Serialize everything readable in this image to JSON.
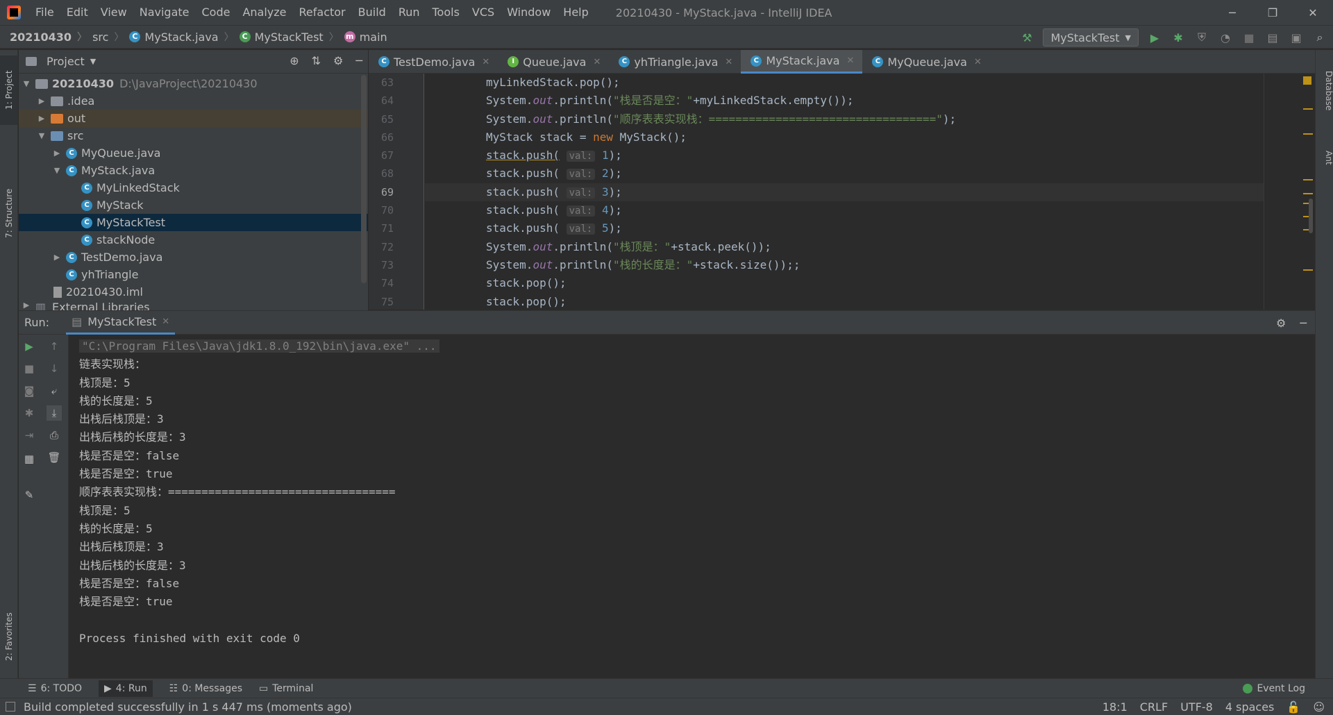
{
  "menu": [
    "File",
    "Edit",
    "View",
    "Navigate",
    "Code",
    "Analyze",
    "Refactor",
    "Build",
    "Run",
    "Tools",
    "VCS",
    "Window",
    "Help"
  ],
  "window_title": "20210430 - MyStack.java - IntelliJ IDEA",
  "breadcrumb": [
    "20210430",
    "src",
    "MyStack.java",
    "MyStackTest",
    "main"
  ],
  "run_config": "MyStackTest",
  "project_panel": {
    "title": "Project",
    "tree": [
      {
        "label": "20210430",
        "path": "D:\\JavaProject\\20210430"
      },
      {
        "label": ".idea"
      },
      {
        "label": "out"
      },
      {
        "label": "src"
      },
      {
        "label": "MyQueue.java"
      },
      {
        "label": "MyStack.java"
      },
      {
        "label": "MyLinkedStack"
      },
      {
        "label": "MyStack"
      },
      {
        "label": "MyStackTest"
      },
      {
        "label": "stackNode"
      },
      {
        "label": "TestDemo.java"
      },
      {
        "label": "yhTriangle"
      },
      {
        "label": "20210430.iml"
      },
      {
        "label": "External Libraries"
      }
    ]
  },
  "editor_tabs": [
    "TestDemo.java",
    "Queue.java",
    "yhTriangle.java",
    "MyStack.java",
    "MyQueue.java"
  ],
  "line_numbers": [
    "63",
    "64",
    "65",
    "66",
    "67",
    "68",
    "69",
    "70",
    "71",
    "72",
    "73",
    "74",
    "75"
  ],
  "code": {
    "l63": "myLinkedStack.pop();",
    "l64a": "System.",
    "l64b": "out",
    "l64c": ".println(",
    "l64d": "\"栈是否是空：\"",
    "l64e": "+myLinkedStack.empty());",
    "l65a": "System.",
    "l65b": "out",
    "l65c": ".println(",
    "l65d": "\"顺序表表实现栈：==================================\"",
    "l65e": ");",
    "l66a": "MyStack stack = ",
    "l66b": "new",
    "l66c": " MyStack();",
    "push": "stack.push(",
    "hint": "val:",
    "v67": "1",
    "v68": "2",
    "v69": "3",
    "v70": "4",
    "v71": "5",
    "push_end": ");",
    "l72a": "System.",
    "l72b": "out",
    "l72c": ".println(",
    "l72d": "\"栈顶是：\"",
    "l72e": "+stack.peek());",
    "l73a": "System.",
    "l73b": "out",
    "l73c": ".println(",
    "l73d": "\"栈的长度是：\"",
    "l73e": "+stack.size());;",
    "l74": "stack.pop();",
    "l75": "stack.pop();"
  },
  "run_panel": {
    "label": "Run:",
    "tab": "MyStackTest",
    "output": [
      "\"C:\\Program Files\\Java\\jdk1.8.0_192\\bin\\java.exe\" ...",
      "链表实现栈：",
      "栈顶是：5",
      "栈的长度是：5",
      "出栈后栈顶是：3",
      "出栈后栈的长度是：3",
      "栈是否是空：false",
      "栈是否是空：true",
      "顺序表表实现栈：==================================",
      "栈顶是：5",
      "栈的长度是：5",
      "出栈后栈顶是：3",
      "出栈后栈的长度是：3",
      "栈是否是空：false",
      "栈是否是空：true",
      "",
      "Process finished with exit code 0"
    ]
  },
  "side_tabs": {
    "project": "1: Project",
    "structure": "7: Structure",
    "favorites": "2: Favorites",
    "database": "Database",
    "ant": "Ant"
  },
  "bottom_tools": [
    "6: TODO",
    "4: Run",
    "0: Messages",
    "Terminal"
  ],
  "event_log": "Event Log",
  "status": {
    "message": "Build completed successfully in 1 s 447 ms (moments ago)",
    "position": "18:1",
    "line_sep": "CRLF",
    "encoding": "UTF-8",
    "indent": "4 spaces"
  }
}
